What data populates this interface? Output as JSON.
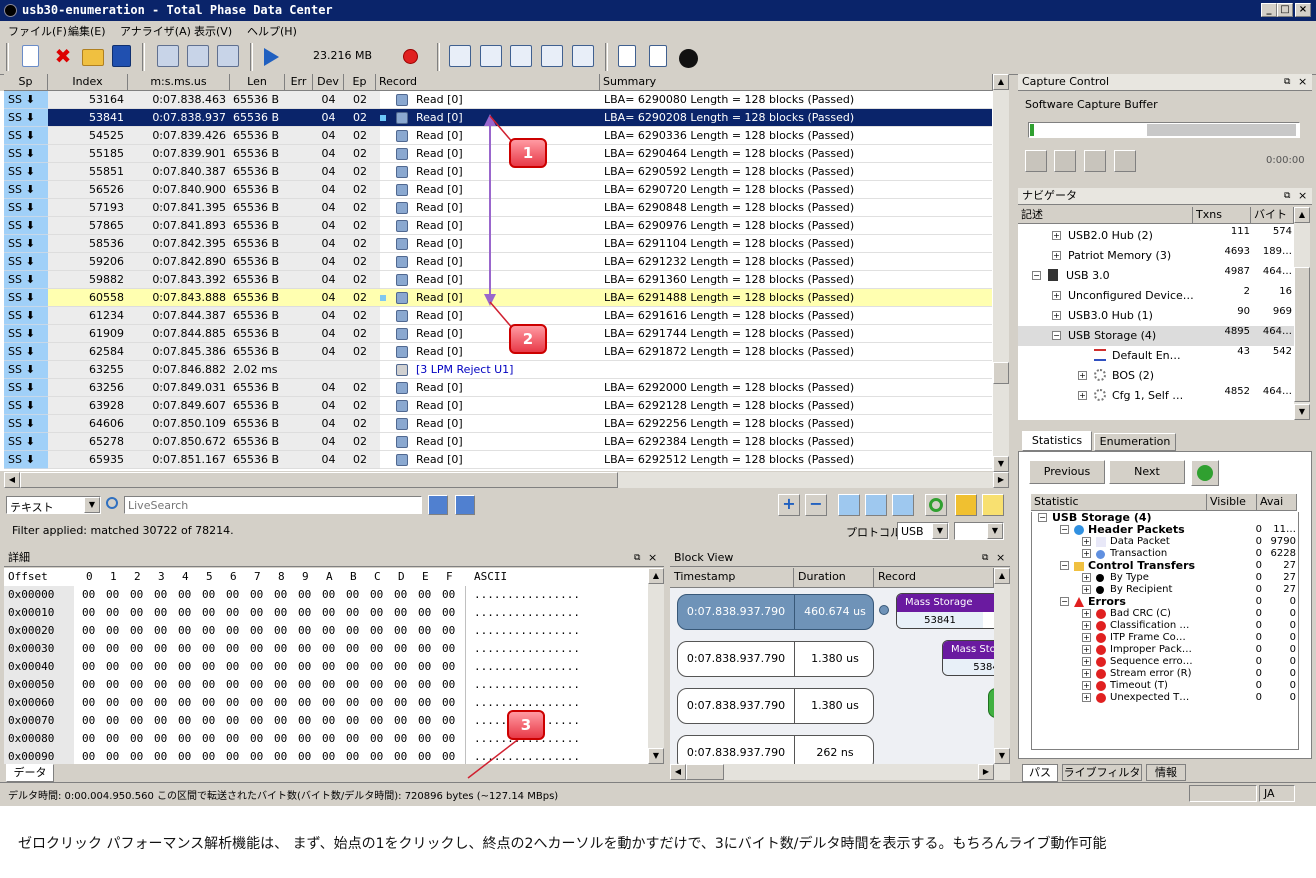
{
  "window": {
    "title": "usb30-enumeration - Total Phase Data Center"
  },
  "menu": [
    "ファイル(F)",
    "編集(E)",
    "アナライザ(A)",
    "表示(V)",
    "ヘルプ(H)"
  ],
  "toolbar": {
    "capture_size": "23.216 MB"
  },
  "columns": [
    "Sp",
    "Index",
    "m:s.ms.us",
    "Len",
    "Err",
    "Dev",
    "Ep",
    "Record",
    "Summary"
  ],
  "rows": [
    {
      "sp": "SS",
      "idx": "53164",
      "t": "0:07.838.463",
      "len": "65536 B",
      "dev": "04",
      "ep": "02",
      "rec": "Read [0]",
      "sum": "LBA= 6290080 Length = 128 blocks (Passed)"
    },
    {
      "sp": "SS",
      "idx": "53841",
      "t": "0:07.838.937",
      "len": "65536 B",
      "dev": "04",
      "ep": "02",
      "rec": "Read [0]",
      "sum": "LBA= 6290208 Length = 128 blocks (Passed)"
    },
    {
      "sp": "SS",
      "idx": "54525",
      "t": "0:07.839.426",
      "len": "65536 B",
      "dev": "04",
      "ep": "02",
      "rec": "Read [0]",
      "sum": "LBA= 6290336 Length = 128 blocks (Passed)"
    },
    {
      "sp": "SS",
      "idx": "55185",
      "t": "0:07.839.901",
      "len": "65536 B",
      "dev": "04",
      "ep": "02",
      "rec": "Read [0]",
      "sum": "LBA= 6290464 Length = 128 blocks (Passed)"
    },
    {
      "sp": "SS",
      "idx": "55851",
      "t": "0:07.840.387",
      "len": "65536 B",
      "dev": "04",
      "ep": "02",
      "rec": "Read [0]",
      "sum": "LBA= 6290592 Length = 128 blocks (Passed)"
    },
    {
      "sp": "SS",
      "idx": "56526",
      "t": "0:07.840.900",
      "len": "65536 B",
      "dev": "04",
      "ep": "02",
      "rec": "Read [0]",
      "sum": "LBA= 6290720 Length = 128 blocks (Passed)"
    },
    {
      "sp": "SS",
      "idx": "57193",
      "t": "0:07.841.395",
      "len": "65536 B",
      "dev": "04",
      "ep": "02",
      "rec": "Read [0]",
      "sum": "LBA= 6290848 Length = 128 blocks (Passed)"
    },
    {
      "sp": "SS",
      "idx": "57865",
      "t": "0:07.841.893",
      "len": "65536 B",
      "dev": "04",
      "ep": "02",
      "rec": "Read [0]",
      "sum": "LBA= 6290976 Length = 128 blocks (Passed)"
    },
    {
      "sp": "SS",
      "idx": "58536",
      "t": "0:07.842.395",
      "len": "65536 B",
      "dev": "04",
      "ep": "02",
      "rec": "Read [0]",
      "sum": "LBA= 6291104 Length = 128 blocks (Passed)"
    },
    {
      "sp": "SS",
      "idx": "59206",
      "t": "0:07.842.890",
      "len": "65536 B",
      "dev": "04",
      "ep": "02",
      "rec": "Read [0]",
      "sum": "LBA= 6291232 Length = 128 blocks (Passed)"
    },
    {
      "sp": "SS",
      "idx": "59882",
      "t": "0:07.843.392",
      "len": "65536 B",
      "dev": "04",
      "ep": "02",
      "rec": "Read [0]",
      "sum": "LBA= 6291360 Length = 128 blocks (Passed)"
    },
    {
      "sp": "SS",
      "idx": "60558",
      "t": "0:07.843.888",
      "len": "65536 B",
      "dev": "04",
      "ep": "02",
      "rec": "Read [0]",
      "sum": "LBA= 6291488 Length = 128 blocks (Passed)"
    },
    {
      "sp": "SS",
      "idx": "61234",
      "t": "0:07.844.387",
      "len": "65536 B",
      "dev": "04",
      "ep": "02",
      "rec": "Read [0]",
      "sum": "LBA= 6291616 Length = 128 blocks (Passed)"
    },
    {
      "sp": "SS",
      "idx": "61909",
      "t": "0:07.844.885",
      "len": "65536 B",
      "dev": "04",
      "ep": "02",
      "rec": "Read [0]",
      "sum": "LBA= 6291744 Length = 128 blocks (Passed)"
    },
    {
      "sp": "SS",
      "idx": "62584",
      "t": "0:07.845.386",
      "len": "65536 B",
      "dev": "04",
      "ep": "02",
      "rec": "Read [0]",
      "sum": "LBA= 6291872 Length = 128 blocks (Passed)"
    },
    {
      "sp": "SS",
      "idx": "63255",
      "t": "0:07.846.882",
      "len": "2.02 ms",
      "dev": "",
      "ep": "",
      "rec": "[3 LPM Reject U1]",
      "sum": ""
    },
    {
      "sp": "SS",
      "idx": "63256",
      "t": "0:07.849.031",
      "len": "65536 B",
      "dev": "04",
      "ep": "02",
      "rec": "Read [0]",
      "sum": "LBA= 6292000 Length = 128 blocks (Passed)"
    },
    {
      "sp": "SS",
      "idx": "63928",
      "t": "0:07.849.607",
      "len": "65536 B",
      "dev": "04",
      "ep": "02",
      "rec": "Read [0]",
      "sum": "LBA= 6292128 Length = 128 blocks (Passed)"
    },
    {
      "sp": "SS",
      "idx": "64606",
      "t": "0:07.850.109",
      "len": "65536 B",
      "dev": "04",
      "ep": "02",
      "rec": "Read [0]",
      "sum": "LBA= 6292256 Length = 128 blocks (Passed)"
    },
    {
      "sp": "SS",
      "idx": "65278",
      "t": "0:07.850.672",
      "len": "65536 B",
      "dev": "04",
      "ep": "02",
      "rec": "Read [0]",
      "sum": "LBA= 6292384 Length = 128 blocks (Passed)"
    },
    {
      "sp": "SS",
      "idx": "65935",
      "t": "0:07.851.167",
      "len": "65536 B",
      "dev": "04",
      "ep": "02",
      "rec": "Read [0]",
      "sum": "LBA= 6292512 Length = 128 blocks (Passed)"
    }
  ],
  "filter": {
    "type": "テキスト",
    "placeholder": "LiveSearch",
    "status": "Filter applied: matched 30722 of 78214.",
    "protocol_label": "プロトコル:",
    "protocol": "USB"
  },
  "detail": {
    "title": "詳細",
    "offset_label": "Offset",
    "hex_cols": [
      "0",
      "1",
      "2",
      "3",
      "4",
      "5",
      "6",
      "7",
      "8",
      "9",
      "A",
      "B",
      "C",
      "D",
      "E",
      "F"
    ],
    "ascii_label": "ASCII",
    "offsets": [
      "0x00000",
      "0x00010",
      "0x00020",
      "0x00030",
      "0x00040",
      "0x00050",
      "0x00060",
      "0x00070",
      "0x00080",
      "0x00090"
    ],
    "byte": "00",
    "ascii": "................",
    "tab": "データ"
  },
  "blockview": {
    "title": "Block View",
    "cols": [
      "Timestamp",
      "Duration",
      "Record"
    ],
    "blocks": [
      {
        "ts": "0:07.838.937.790",
        "dur": "460.674 us"
      },
      {
        "ts": "0:07.838.937.790",
        "dur": "1.380 us"
      },
      {
        "ts": "0:07.838.937.790",
        "dur": "1.380 us"
      },
      {
        "ts": "0:07.838.937.790",
        "dur": "262 ns"
      }
    ],
    "rec1_name": "Mass Storage",
    "rec1_idx": "53841",
    "rec2_name": "Mass Stor",
    "rec2_idx": "5384"
  },
  "status": {
    "delta": "デルタ時間: 0:00.004.950.560  この区間で転送されたバイト数(バイト数/デルタ時間): 720896 bytes (~127.14 MBps)",
    "lang": "JA"
  },
  "capture": {
    "title": "Capture Control",
    "buffer_label": "Software Capture Buffer",
    "buffer_fill": 0.45,
    "time": "0:00:00"
  },
  "navigator": {
    "title": "ナビゲータ",
    "cols": [
      "記述",
      "Txns",
      "バイト"
    ],
    "items": [
      {
        "label": "USB2.0 Hub (2)",
        "txns": "111",
        "bytes": "574"
      },
      {
        "label": "Patriot Memory (3)",
        "txns": "4693",
        "bytes": "189…"
      },
      {
        "label": "USB 3.0",
        "txns": "4987",
        "bytes": "464…"
      },
      {
        "label": "Unconfigured Device…",
        "txns": "2",
        "bytes": "16"
      },
      {
        "label": "USB3.0 Hub (1)",
        "txns": "90",
        "bytes": "969"
      },
      {
        "label": "USB Storage (4)",
        "txns": "4895",
        "bytes": "464…"
      },
      {
        "label": "Default En…",
        "txns": "43",
        "bytes": "542"
      },
      {
        "label": "BOS (2)",
        "txns": "",
        "bytes": ""
      },
      {
        "label": "Cfg 1, Self …",
        "txns": "4852",
        "bytes": "464…"
      }
    ]
  },
  "stats": {
    "tabs": [
      "Statistics",
      "Enumeration"
    ],
    "prev": "Previous",
    "next": "Next",
    "cols": [
      "Statistic",
      "Visible",
      "Avai"
    ],
    "items": [
      {
        "label": "USB Storage (4)",
        "v": "",
        "a": ""
      },
      {
        "label": "Header Packets",
        "v": "0",
        "a": "11…"
      },
      {
        "label": "Data Packet",
        "v": "0",
        "a": "9790"
      },
      {
        "label": "Transaction",
        "v": "0",
        "a": "6228"
      },
      {
        "label": "Control Transfers",
        "v": "0",
        "a": "27"
      },
      {
        "label": "By Type",
        "v": "0",
        "a": "27"
      },
      {
        "label": "By Recipient",
        "v": "0",
        "a": "27"
      },
      {
        "label": "Errors",
        "v": "0",
        "a": "0"
      },
      {
        "label": "Bad CRC (C)",
        "v": "0",
        "a": "0"
      },
      {
        "label": "Classification …",
        "v": "0",
        "a": "0"
      },
      {
        "label": "ITP Frame Co…",
        "v": "0",
        "a": "0"
      },
      {
        "label": "Improper Pack…",
        "v": "0",
        "a": "0"
      },
      {
        "label": "Sequence erro…",
        "v": "0",
        "a": "0"
      },
      {
        "label": "Stream error (R)",
        "v": "0",
        "a": "0"
      },
      {
        "label": "Timeout (T)",
        "v": "0",
        "a": "0"
      },
      {
        "label": "Unexpected T…",
        "v": "0",
        "a": "0"
      }
    ],
    "bottom_tabs": [
      "パス",
      "ライブフィルタ",
      "情報"
    ]
  },
  "callouts": [
    "1",
    "2",
    "3"
  ],
  "caption": "ゼロクリック パフォーマンス解析機能は、 まず、始点の1をクリックし、終点の2へカーソルを動かすだけで、3にバイト数/デルタ時間を表示する。もちろんライブ動作可能",
  "colors": {
    "selected": "#0a246a",
    "highlight": "#ffffb0",
    "sp": "#a0d0f8",
    "arrow": "#9966cc"
  }
}
